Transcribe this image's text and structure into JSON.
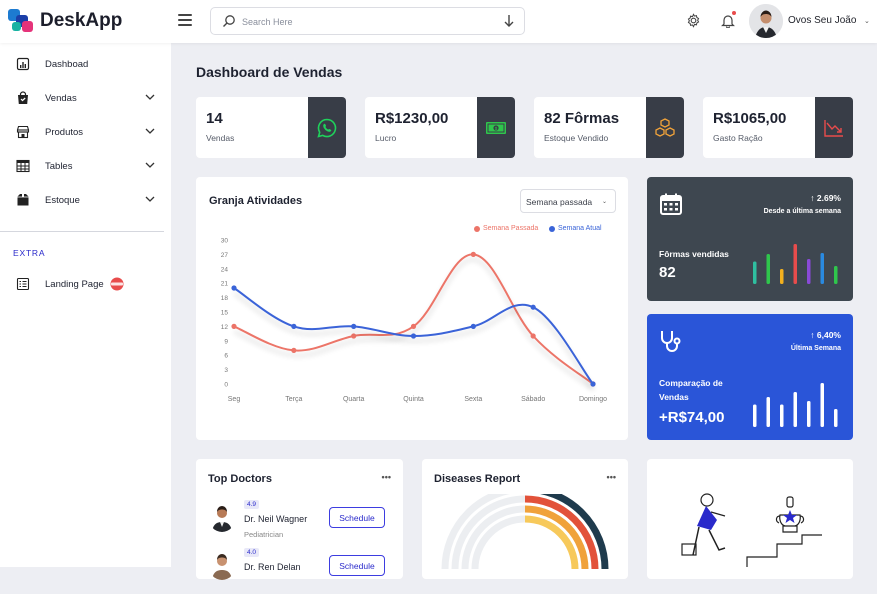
{
  "app": {
    "name": "DeskApp"
  },
  "search": {
    "placeholder": "Search Here"
  },
  "user": {
    "name": "Ovos Seu João"
  },
  "sidebar": {
    "items": [
      {
        "label": "Dashboad"
      },
      {
        "label": "Vendas"
      },
      {
        "label": "Produtos"
      },
      {
        "label": "Tables"
      },
      {
        "label": "Estoque"
      }
    ],
    "extra_heading": "EXTRA",
    "extra_items": [
      {
        "label": "Landing Page"
      }
    ]
  },
  "page": {
    "title": "Dashboard de Vendas"
  },
  "stats": [
    {
      "value": "14",
      "label": "Vendas",
      "icon": "whatsapp-icon",
      "color": "#1fd15b"
    },
    {
      "value": "R$1230,00",
      "label": "Lucro",
      "icon": "money-icon",
      "color": "#2fc64c"
    },
    {
      "value": "82 Fôrmas",
      "label": "Estoque Vendido",
      "icon": "boxes-icon",
      "color": "#f2a33a"
    },
    {
      "value": "R$1065,00",
      "label": "Gasto Ração",
      "icon": "trend-down-icon",
      "color": "#e84c4c"
    }
  ],
  "activity": {
    "title": "Granja Atividades",
    "period": "Semana passada"
  },
  "chart_data": {
    "type": "line",
    "categories": [
      "Seg",
      "Terça",
      "Quarta",
      "Quinta",
      "Sexta",
      "Sábado",
      "Domingo"
    ],
    "series": [
      {
        "name": "Semana Passada",
        "color": "#ec7468",
        "values": [
          12,
          7,
          10,
          12,
          27,
          10,
          0
        ]
      },
      {
        "name": "Semana Atual",
        "color": "#3a64d8",
        "values": [
          20,
          12,
          12,
          10,
          12,
          16,
          0
        ]
      }
    ],
    "yticks": [
      0,
      3,
      6,
      9,
      12,
      15,
      18,
      21,
      24,
      27,
      30
    ],
    "ylim": [
      0,
      30
    ],
    "grid": false,
    "legend": "top-right"
  },
  "mini_cards": [
    {
      "pct": "↑ 2.69%",
      "subtitle": "Desde a última semana",
      "label": "Fôrmas vendidas",
      "value": "82",
      "bg": "#3e4750",
      "bars": [
        {
          "h": 0.45,
          "c": "#2fbfa0"
        },
        {
          "h": 0.6,
          "c": "#2fc64c"
        },
        {
          "h": 0.3,
          "c": "#f2b01e"
        },
        {
          "h": 0.8,
          "c": "#e84c4c"
        },
        {
          "h": 0.5,
          "c": "#8a4ad8"
        },
        {
          "h": 0.62,
          "c": "#2a8ae0"
        },
        {
          "h": 0.36,
          "c": "#2fc64c"
        }
      ]
    },
    {
      "pct": "↑ 6,40%",
      "subtitle": "Última Semana",
      "label": "Comparação de Vendas",
      "value": "+R$74,00",
      "bg": "#2a55d8",
      "bars": [
        {
          "h": 0.45,
          "c": "#ffffff"
        },
        {
          "h": 0.6,
          "c": "#ffffff"
        },
        {
          "h": 0.45,
          "c": "#ffffff"
        },
        {
          "h": 0.7,
          "c": "#ffffff"
        },
        {
          "h": 0.52,
          "c": "#ffffff"
        },
        {
          "h": 0.88,
          "c": "#ffffff"
        },
        {
          "h": 0.36,
          "c": "#ffffff"
        }
      ]
    }
  ],
  "top_doctors": {
    "title": "Top Doctors",
    "more": "•••",
    "doctors": [
      {
        "rating": "4.9",
        "name": "Dr. Neil Wagner",
        "specialty": "Pediatrician",
        "button": "Schedule"
      },
      {
        "rating": "4.0",
        "name": "Dr. Ren Delan",
        "specialty": "",
        "button": "Schedule"
      }
    ]
  },
  "diseases": {
    "title": "Diseases Report",
    "more": "•••"
  }
}
